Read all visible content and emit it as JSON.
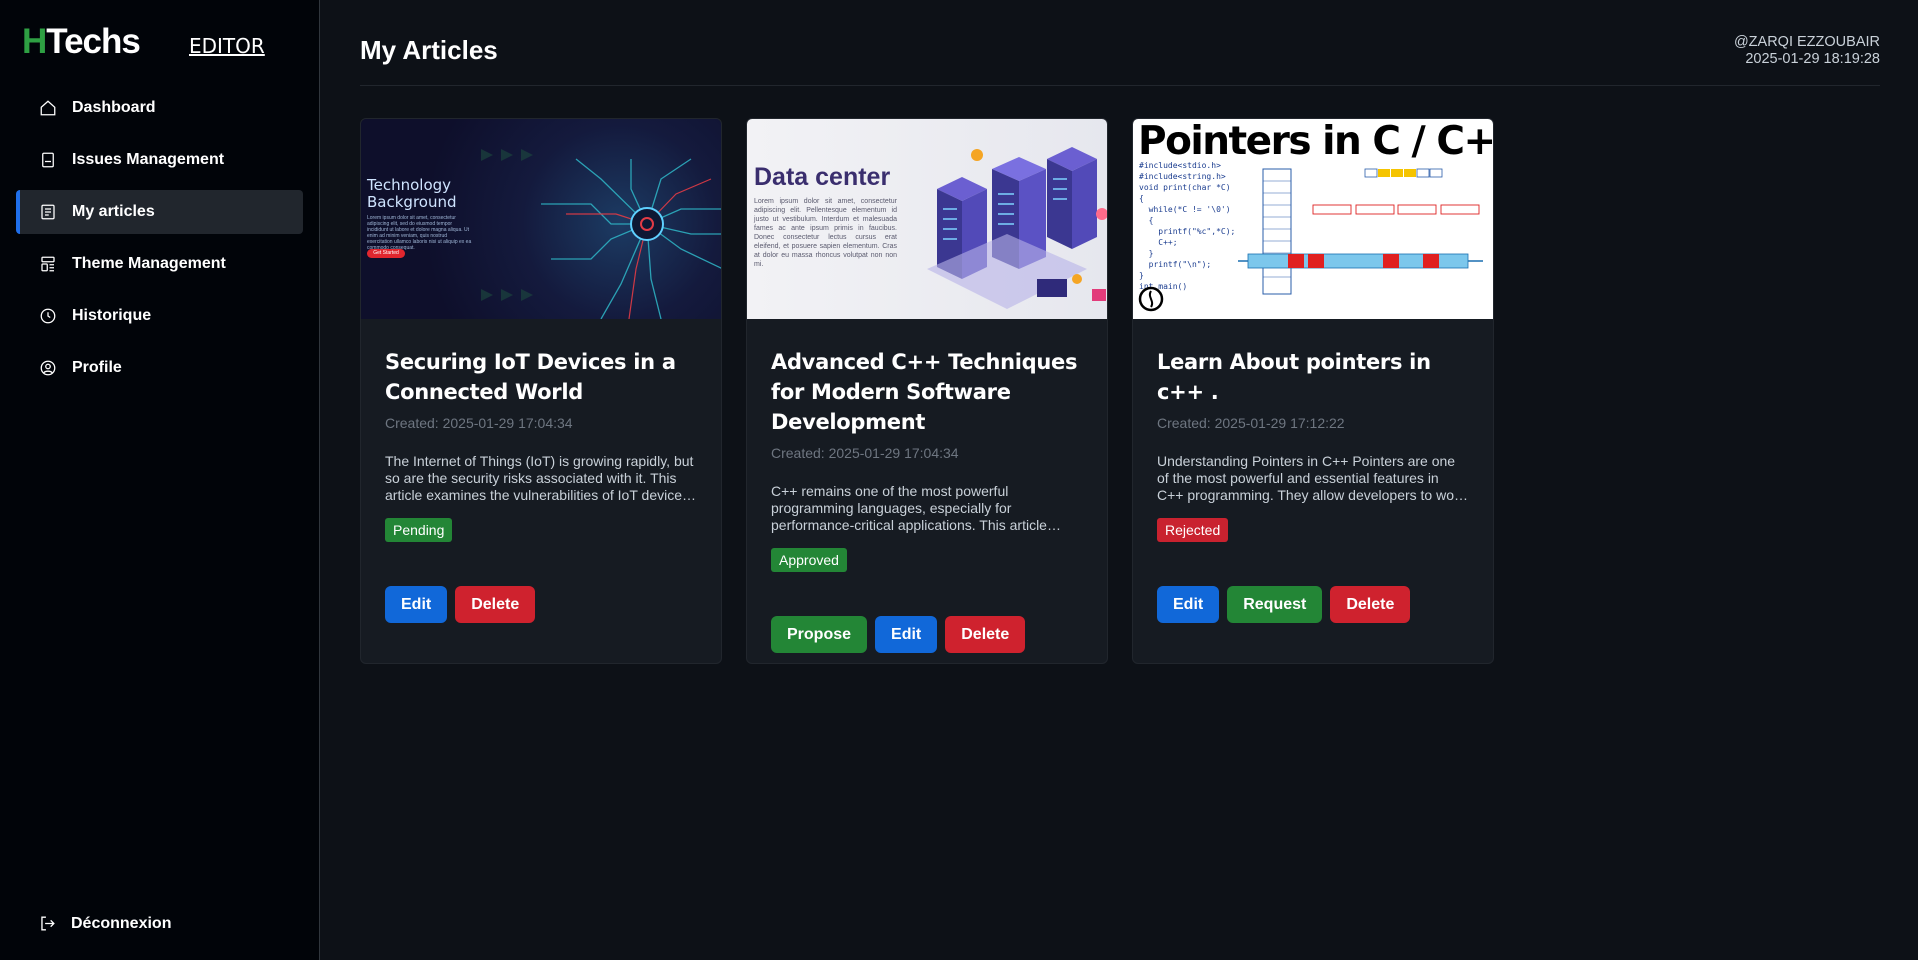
{
  "brand": {
    "logo_h": "H",
    "logo_rest": "Techs",
    "role": "EDITOR"
  },
  "sidebar": {
    "items": [
      {
        "label": "Dashboard",
        "icon": "home-icon"
      },
      {
        "label": "Issues Management",
        "icon": "book-icon"
      },
      {
        "label": "My articles",
        "icon": "article-icon",
        "active": true
      },
      {
        "label": "Theme Management",
        "icon": "layout-icon"
      },
      {
        "label": "Historique",
        "icon": "clock-icon"
      },
      {
        "label": "Profile",
        "icon": "user-circle-icon"
      }
    ],
    "logout": {
      "label": "Déconnexion",
      "icon": "logout-icon"
    }
  },
  "header": {
    "title": "My Articles",
    "username": "@ZARQI EZZOUBAIR",
    "datetime": "2025-01-29 18:19:28"
  },
  "articles": [
    {
      "image": {
        "title_line1": "Technology",
        "title_line2": "Background",
        "text": "Lorem ipsum dolor sit amet, consectetur adipiscing elit, sed do eiusmod tempor incididunt ut labore et dolore magna aliqua. Ut enim ad minim veniam, quis nostrud exercitation ullamco laboris nisi ut aliquip ex ea commodo consequat.",
        "button": "Get Started"
      },
      "title": "Securing IoT Devices in a Connected World",
      "created": "Created: 2025-01-29 17:04:34",
      "excerpt": "The Internet of Things (IoT) is growing rapidly, but so are the security risks associated with it. This article examines the vulnerabilities of IoT devices and strategies to protect them.",
      "status": "Pending",
      "buttons": [
        "Edit",
        "Delete"
      ]
    },
    {
      "image": {
        "title": "Data center",
        "text": "Lorem ipsum dolor sit amet, consectetur adipiscing elit. Pellentesque elementum id justo ut vestibulum. Interdum et malesuada fames ac ante ipsum primis in faucibus. Donec consectetur lectus cursus erat eleifend, et posuere sapien elementum. Cras at dolor eu massa rhoncus volutpat non non mi."
      },
      "title": "Advanced C++ Techniques for Modern Software Development",
      "created": "Created: 2025-01-29 17:04:34",
      "excerpt": "C++ remains one of the most powerful programming languages, especially for performance-critical applications. This article explores advanced techniques for modern development.",
      "status": "Approved",
      "buttons": [
        "Propose",
        "Edit",
        "Delete"
      ]
    },
    {
      "image": {
        "title": "Pointers in C / C++",
        "code": "#include<stdio.h>\n#include<string.h>\nvoid print(char *C)\n{\n  while(*C != '\\0')\n  {\n    printf(\"%c\",*C);\n    C++;\n  }\n  printf(\"\\n\");\n}\nint main()"
      },
      "title": "Learn About pointers in c++ .",
      "created": "Created: 2025-01-29 17:12:22",
      "excerpt": "Understanding Pointers in C++ Pointers are one of the most powerful and essential features in C++ programming. They allow developers to work directly with memory addresses.",
      "status": "Rejected",
      "buttons": [
        "Edit",
        "Request",
        "Delete"
      ]
    }
  ]
}
